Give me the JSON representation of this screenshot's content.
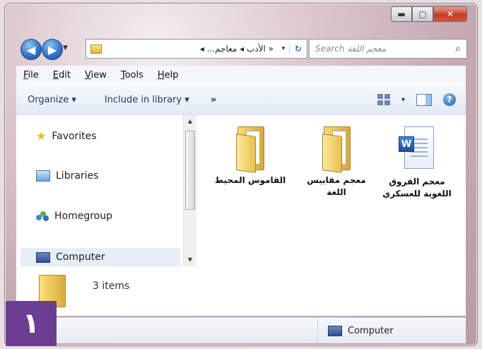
{
  "window": {
    "caption_buttons": {
      "min_icon": "minimize-icon",
      "max_icon": "maximize-icon",
      "close_icon": "close-icon",
      "close_glyph": "✕",
      "min_glyph": "▬",
      "max_glyph": "▢"
    }
  },
  "nav": {
    "back_glyph": "◀",
    "forward_glyph": "▶",
    "dropdown_glyph": "▼",
    "address": {
      "breadcrumb": "« الأدب ◂ معاجم... ◂",
      "dropdown_glyph": "▾",
      "refresh_glyph": "↻"
    },
    "search": {
      "placeholder": "Search معجم اللغة",
      "icon_glyph": "⌕"
    }
  },
  "menubar": {
    "items": [
      "File",
      "Edit",
      "View",
      "Tools",
      "Help"
    ]
  },
  "toolbar": {
    "organize": "Organize ▾",
    "include_in_library": "Include in library ▾",
    "more": "»",
    "views_dropdown": "▾",
    "help_glyph": "?"
  },
  "nav_pane": {
    "items": [
      {
        "label": "Favorites",
        "icon": "star-icon"
      },
      {
        "label": "Libraries",
        "icon": "libraries-icon"
      },
      {
        "label": "Homegroup",
        "icon": "homegroup-icon"
      },
      {
        "label": "Computer",
        "icon": "computer-icon"
      }
    ],
    "scroll_up": "▲",
    "scroll_down": "▼"
  },
  "files": [
    {
      "name": "القاموس المحيط",
      "type": "folder"
    },
    {
      "name": "معجم مقاييس اللغة",
      "type": "folder"
    },
    {
      "name": "معجم الفروق اللغوية للعسكري",
      "type": "word-document",
      "glyph": "W"
    }
  ],
  "details": {
    "count": "3 items"
  },
  "status": {
    "location": "Computer"
  },
  "badge": {
    "number": "١"
  },
  "colors": {
    "badge": "#6b3d93",
    "close": "#c33b23",
    "nav_button": "#2c6ec4"
  }
}
